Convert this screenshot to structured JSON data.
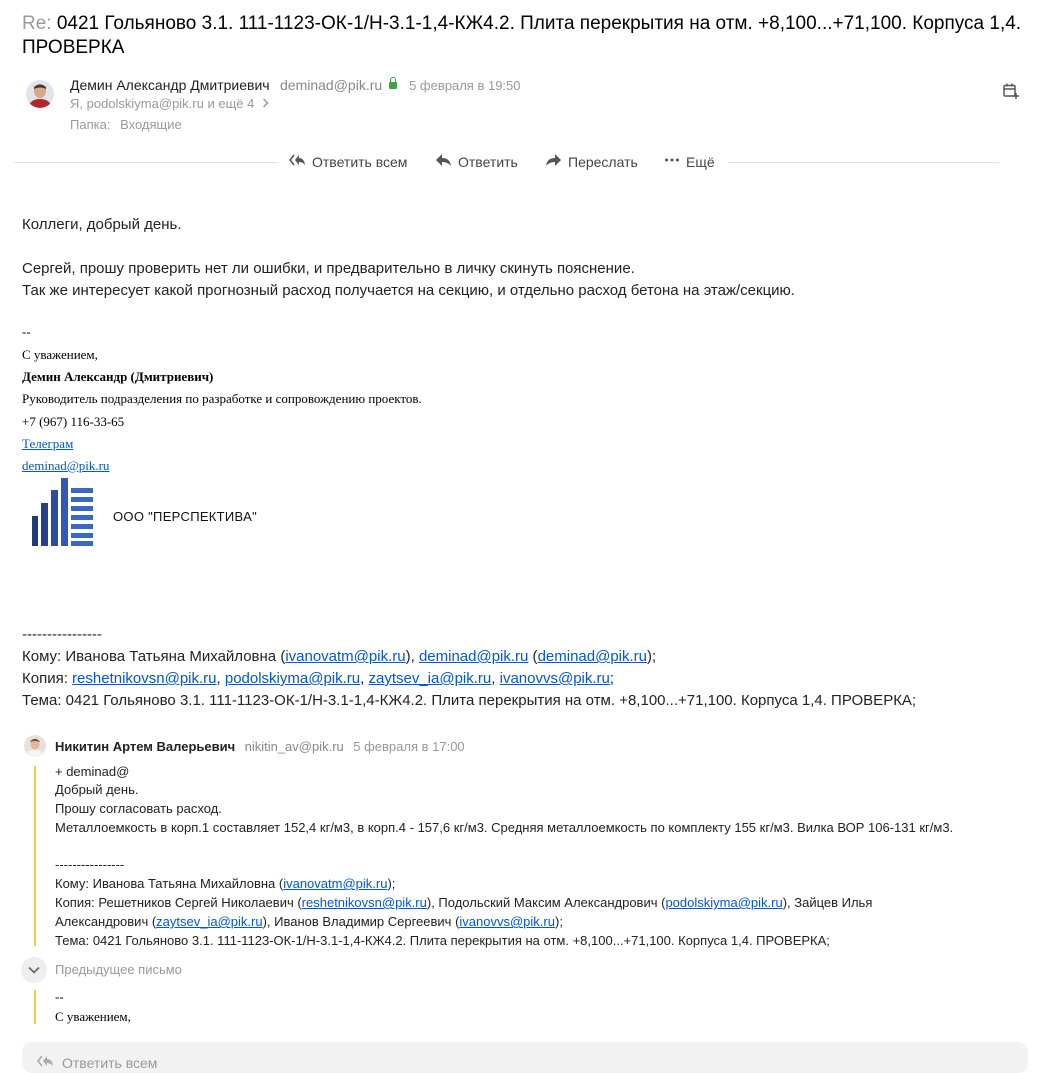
{
  "subject": {
    "prefix": "Re:",
    "text": " 0421 Гольяново 3.1. 111-1123-ОК-1/Н-3.1-1,4-КЖ4.2. Плита перекрытия на отм. +8,100...+71,100. Корпуса 1,4. ПРОВЕРКА"
  },
  "message": {
    "sender_name": "Демин Александр Дмитриевич",
    "sender_email": "deminad@pik.ru",
    "date": "5 февраля в 19:50",
    "recipients": "Я, podolskiyma@pik.ru и ещё 4",
    "folder_label": "Папка:",
    "folder_value": "Входящие"
  },
  "actions": {
    "reply_all": "Ответить всем",
    "reply": "Ответить",
    "forward": "Переслать",
    "more": "Ещё"
  },
  "body": {
    "greeting": "Коллеги, добрый день.",
    "line1": "Сергей, прошу проверить нет ли ошибки, и предварительно в личку скинуть пояснение.",
    "line2": "Так же интересует какой прогнозный расход получается на секцию, и отдельно расход бетона на этаж/секцию."
  },
  "signature": {
    "dash": "--",
    "regards": "С уважением,",
    "name": "Демин Александр (Дмитриевич)",
    "position": "Руководитель подразделения по разработке и сопровождению проектов.",
    "phone": "+7 (967) 116-33-65",
    "telegram": "Телеграм",
    "email": "deminad@pik.ru",
    "company": "ООО \"ПЕРСПЕКТИВА\""
  },
  "fwd_header": {
    "separator": "----------------",
    "to_label": "Кому:",
    "to_name": " Иванова Татьяна Михайловна (",
    "to_email1": "ivanovatm@pik.ru",
    "to_mid": "), ",
    "to_email2": "deminad@pik.ru",
    "to_mid2": " (",
    "to_email3": "deminad@pik.ru",
    "to_end": ");",
    "cc_label": "Копия:",
    "cc_email1": "reshetnikovsn@pik.ru",
    "cc_email2": "podolskiyma@pik.ru",
    "cc_email3": "zaytsev_ia@pik.ru",
    "cc_email4": "ivanovvs@pik.ru",
    "subject_line": "Тема: 0421 Гольяново 3.1. 111-1123-ОК-1/Н-3.1-1,4-КЖ4.2. Плита перекрытия на отм. +8,100...+71,100. Корпуса 1,4. ПРОВЕРКА;"
  },
  "quoted": {
    "sender_name": "Никитин Артем Валерьевич",
    "sender_email": "nikitin_av@pik.ru",
    "date": "5 февраля в 17:00",
    "line1": "+ deminad@",
    "line2": "Добрый день.",
    "line3": "Прошу согласовать расход.",
    "line4": "Металлоемкость в корп.1 составляет 152,4 кг/м3, в корп.4 - 157,6 кг/м3. Средняя металлоемкость по комплекту 155 кг/м3. Вилка ВОР 106-131 кг/м3.",
    "separator": "----------------",
    "to_prefix": "Кому: Иванова Татьяна Михайловна (",
    "to_email": "ivanovatm@pik.ru",
    "to_end": ");",
    "cc_prefix": "Копия: Решетников Сергей Николаевич (",
    "cc_email1": "reshetnikovsn@pik.ru",
    "cc_mid1": "), Подольский Максим Александрович (",
    "cc_email2": "podolskiyma@pik.ru",
    "cc_mid2": "), Зайцев Илья",
    "cc_line2_prefix": "Александрович (",
    "cc_email3": "zaytsev_ia@pik.ru",
    "cc_mid3": "), Иванов Владимир Сергеевич (",
    "cc_email4": "ivanovvs@pik.ru",
    "cc_end": ");",
    "subject_line": "Тема: 0421 Гольяново 3.1. 111-1123-ОК-1/Н-3.1-1,4-КЖ4.2. Плита перекрытия на отм. +8,100...+71,100. Корпуса 1,4. ПРОВЕРКА;"
  },
  "previous": {
    "label": "Предыдущее письмо",
    "dash": "--",
    "regards": "С уважением,"
  },
  "reply_box": {
    "label": "Ответить всем"
  }
}
